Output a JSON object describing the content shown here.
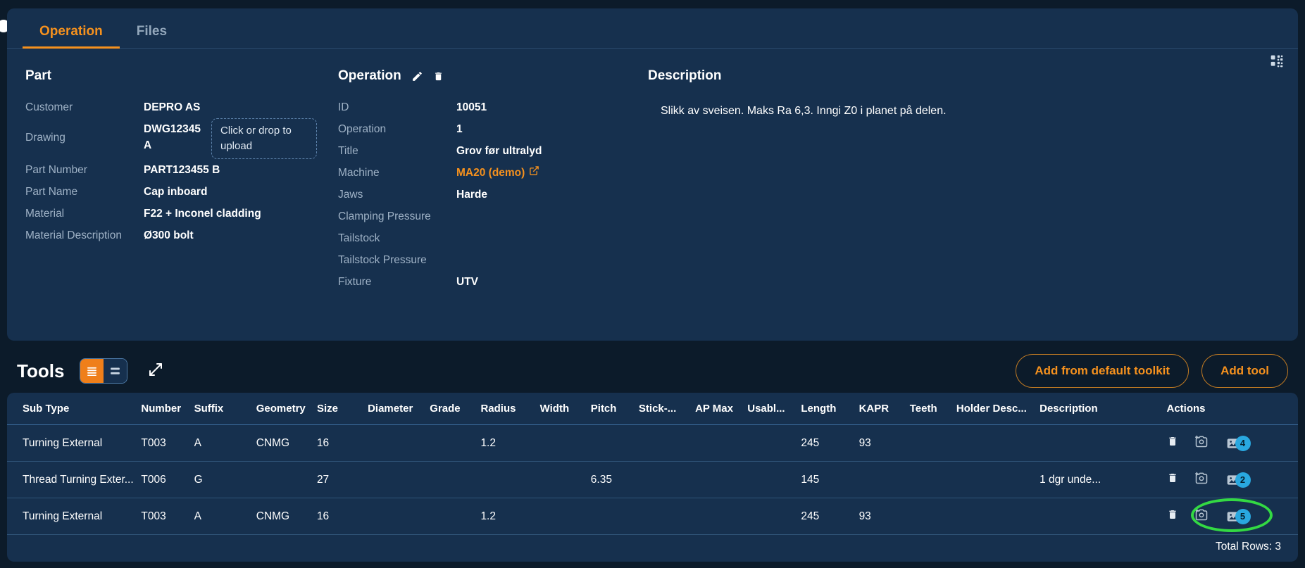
{
  "tabs": [
    {
      "label": "Operation",
      "active": true
    },
    {
      "label": "Files",
      "active": false
    }
  ],
  "part": {
    "title": "Part",
    "fields": [
      {
        "label": "Customer",
        "value": "DEPRO AS"
      },
      {
        "label": "Drawing",
        "value": "DWG12345 A"
      },
      {
        "label": "Part Number",
        "value": "PART123455 B"
      },
      {
        "label": "Part Name",
        "value": "Cap inboard"
      },
      {
        "label": "Material",
        "value": "F22 + Inconel cladding"
      },
      {
        "label": "Material Description",
        "value": "Ø300 bolt"
      }
    ],
    "upload_dropzone": "Click or drop to upload"
  },
  "operation": {
    "title": "Operation",
    "edit_icon": "pencil-icon",
    "delete_icon": "trash-icon",
    "fields": [
      {
        "label": "ID",
        "value": "10051"
      },
      {
        "label": "Operation",
        "value": "1"
      },
      {
        "label": "Title",
        "value": "Grov før ultralyd"
      },
      {
        "label": "Machine",
        "value": "MA20 (demo)",
        "link": true
      },
      {
        "label": "Jaws",
        "value": "Harde"
      },
      {
        "label": "Clamping Pressure",
        "value": ""
      },
      {
        "label": "Tailstock",
        "value": ""
      },
      {
        "label": "Tailstock Pressure",
        "value": ""
      },
      {
        "label": "Fixture",
        "value": "UTV"
      }
    ]
  },
  "description": {
    "title": "Description",
    "text": "Slikk av sveisen. Maks Ra 6,3. Inngi Z0 i planet på delen."
  },
  "tools": {
    "title": "Tools",
    "view_compact_icon": "list-compact-icon",
    "view_comfortable_icon": "list-comfortable-icon",
    "expand_icon": "expand-arrows-icon",
    "add_from_default_toolkit": "Add from default toolkit",
    "add_tool": "Add tool",
    "columns": [
      "Sub Type",
      "Number",
      "Suffix",
      "Geometry",
      "Size",
      "Diameter",
      "Grade",
      "Radius",
      "Width",
      "Pitch",
      "Stick-...",
      "AP Max",
      "Usabl...",
      "Length",
      "KAPR",
      "Teeth",
      "Holder Desc...",
      "Description",
      "Actions"
    ],
    "rows": [
      {
        "sub_type": "Turning External",
        "number": "T003",
        "suffix": "A",
        "geometry": "CNMG",
        "size": "16",
        "diameter": "",
        "grade": "",
        "radius": "1.2",
        "width": "",
        "pitch": "",
        "stick": "",
        "ap_max": "",
        "usable": "",
        "length": "245",
        "kapr": "93",
        "teeth": "",
        "holder_desc": "",
        "description": "",
        "image_count": "4",
        "highlight": false
      },
      {
        "sub_type": "Thread Turning Exter...",
        "number": "T006",
        "suffix": "G",
        "geometry": "",
        "size": "27",
        "diameter": "",
        "grade": "",
        "radius": "",
        "width": "",
        "pitch": "6.35",
        "stick": "",
        "ap_max": "",
        "usable": "",
        "length": "145",
        "kapr": "",
        "teeth": "",
        "holder_desc": "",
        "description": "1 dgr unde...",
        "image_count": "2",
        "highlight": false
      },
      {
        "sub_type": "Turning External",
        "number": "T003",
        "suffix": "A",
        "geometry": "CNMG",
        "size": "16",
        "diameter": "",
        "grade": "",
        "radius": "1.2",
        "width": "",
        "pitch": "",
        "stick": "",
        "ap_max": "",
        "usable": "",
        "length": "245",
        "kapr": "93",
        "teeth": "",
        "holder_desc": "",
        "description": "",
        "image_count": "5",
        "highlight": true
      }
    ],
    "row_action_icons": [
      "trash-icon",
      "add-photo-icon",
      "image-gallery-icon"
    ],
    "total_rows": "Total Rows: 3"
  },
  "colors": {
    "accent_orange": "#f5911e",
    "panel_blue": "#16304e",
    "page_bg": "#0c1b2a",
    "badge_blue": "#29a8e0",
    "highlight_green": "#33d943"
  }
}
